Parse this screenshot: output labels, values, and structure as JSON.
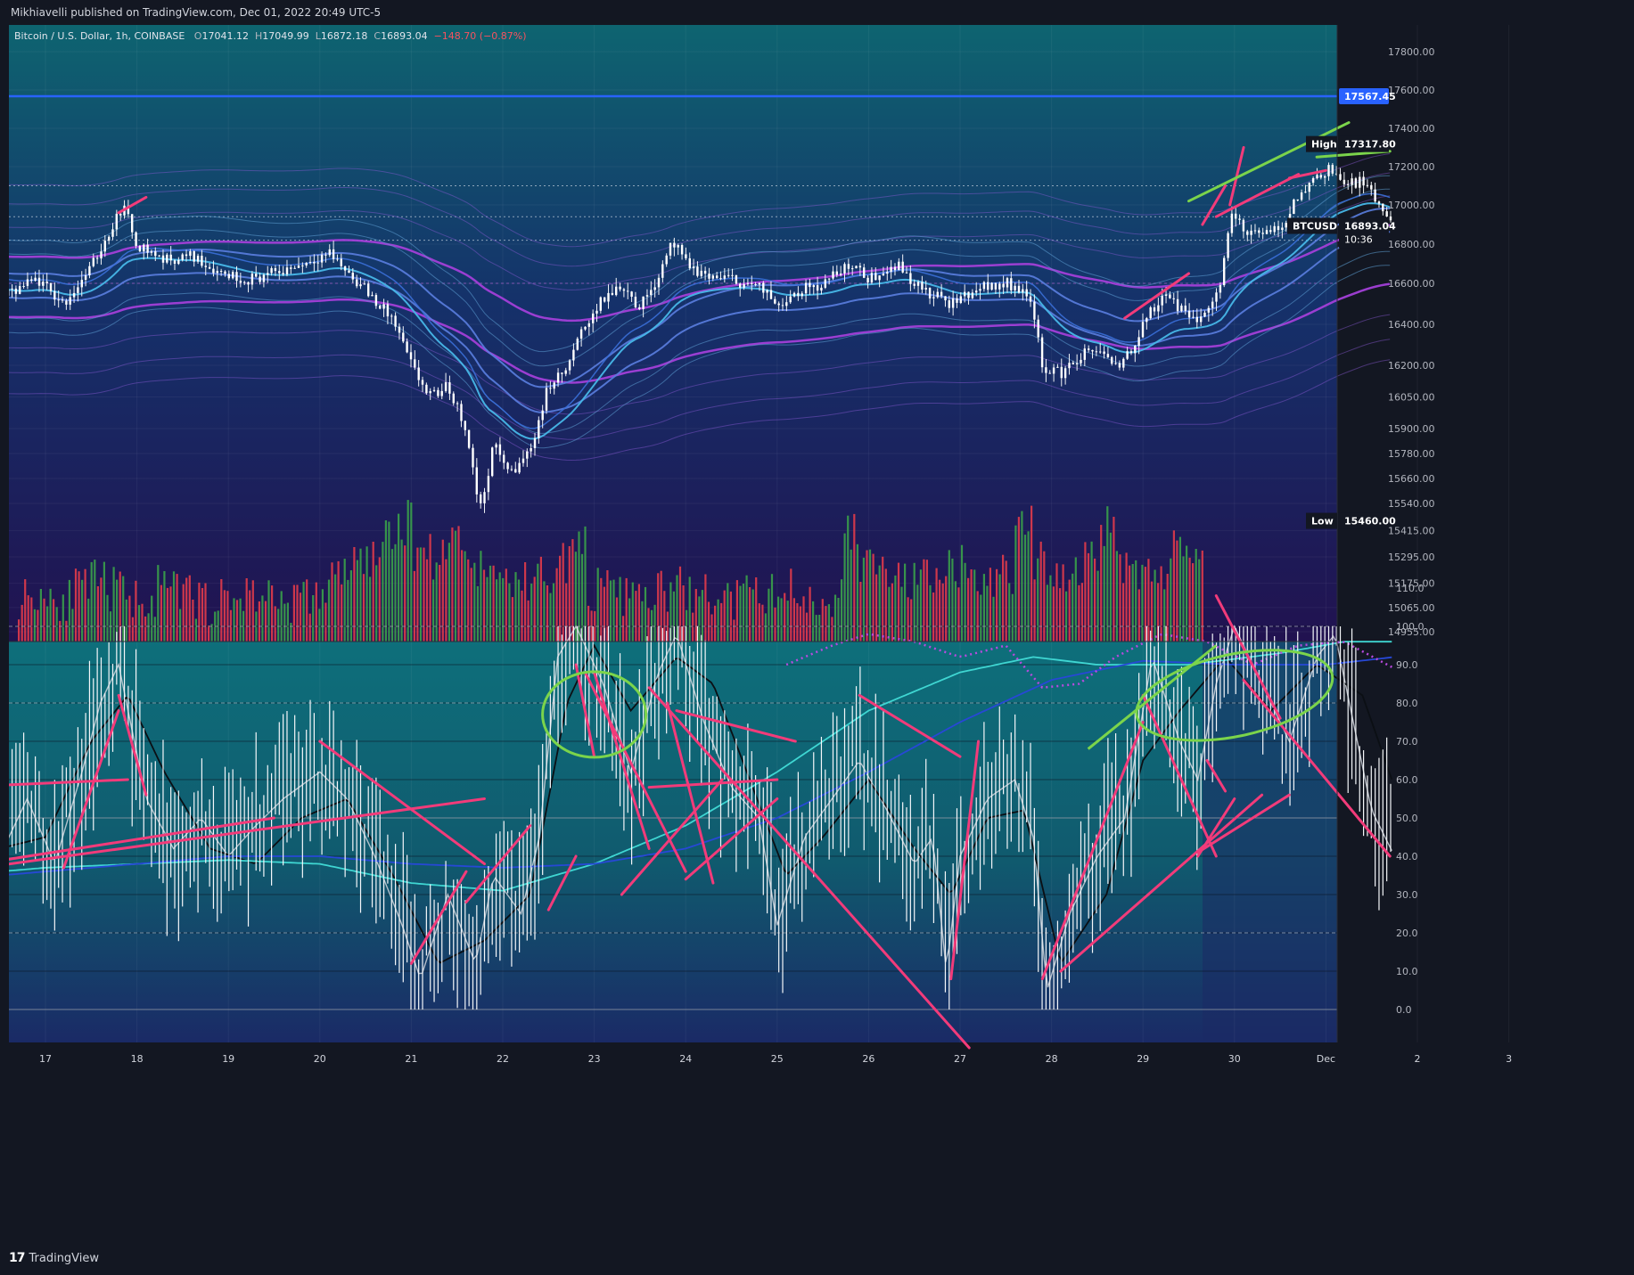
{
  "header": {
    "published": "Mikhiavelli published on TradingView.com, Dec 01, 2022 20:49 UTC-5"
  },
  "legend": {
    "symbol": "Bitcoin / U.S. Dollar, 1h, COINBASE",
    "open_label": "O",
    "open": "17041.12",
    "high_label": "H",
    "high": "17049.99",
    "low_label": "L",
    "low": "16872.18",
    "close_label": "C",
    "close": "16893.04",
    "change": "−148.70 (−0.87%)"
  },
  "branding": {
    "name": "TradingView"
  },
  "colors": {
    "up": "#26a69a",
    "down": "#ef5350",
    "accent": "#2962ff",
    "drawing_pink": "#f23b7a",
    "drawing_green": "#7bd44b",
    "panel_top": "#0d5f6e",
    "panel_bottom": "#221350"
  },
  "chart_data": [
    {
      "type": "candlestick",
      "title": "",
      "symbol": "BTCUSD",
      "timeframe": "1h",
      "x_ticks": [
        "17",
        "18",
        "19",
        "20",
        "21",
        "22",
        "23",
        "24",
        "25",
        "26",
        "27",
        "28",
        "29",
        "30",
        "Dec",
        "2",
        "3"
      ],
      "price_ticks": [
        17800.0,
        17600.0,
        17400.0,
        17200.0,
        17000.0,
        16800.0,
        16600.0,
        16400.0,
        16200.0,
        16050.0,
        15900.0,
        15780.0,
        15660.0,
        15540.0,
        15415.0,
        15295.0,
        15175.0,
        15065.0,
        14955.0
      ],
      "price_tick_labels": [
        "17800.00",
        "17600.00",
        "17400.00",
        "17200.00",
        "17000.00",
        "16800.00",
        "16600.00",
        "16400.00",
        "16200.00",
        "16050.00",
        "15900.00",
        "15780.00",
        "15660.00",
        "15540.00",
        "15415.00",
        "15295.00",
        "15175.00",
        "15065.00",
        "14955.00"
      ],
      "price_labels": [
        {
          "name": "",
          "text": "17567.45",
          "value": 17567.45,
          "color": "#2962ff"
        },
        {
          "name": "High",
          "text": "17317.80",
          "value": 17317.8,
          "color": "#131722"
        },
        {
          "name": "BTCUSD",
          "text": "16893.04",
          "sub": "10:36",
          "value": 16893.04,
          "color": "#131722"
        },
        {
          "name": "Low",
          "text": "15460.00",
          "value": 15460.0,
          "color": "#131722"
        }
      ],
      "horizontal_line": 17567.45,
      "close_path": [
        [
          16.0,
          16580
        ],
        [
          16.3,
          16660
        ],
        [
          16.6,
          16540
        ],
        [
          16.9,
          16620
        ],
        [
          17.2,
          16500
        ],
        [
          17.5,
          16680
        ],
        [
          17.85,
          17000
        ],
        [
          18.0,
          16800
        ],
        [
          18.3,
          16720
        ],
        [
          18.6,
          16740
        ],
        [
          18.9,
          16660
        ],
        [
          19.2,
          16620
        ],
        [
          19.5,
          16650
        ],
        [
          19.8,
          16700
        ],
        [
          20.1,
          16760
        ],
        [
          20.3,
          16660
        ],
        [
          20.6,
          16520
        ],
        [
          20.8,
          16420
        ],
        [
          21.0,
          16200
        ],
        [
          21.2,
          16050
        ],
        [
          21.4,
          16100
        ],
        [
          21.6,
          15900
        ],
        [
          21.75,
          15500
        ],
        [
          21.9,
          15820
        ],
        [
          22.1,
          15680
        ],
        [
          22.3,
          15800
        ],
        [
          22.5,
          16100
        ],
        [
          22.7,
          16180
        ],
        [
          22.9,
          16400
        ],
        [
          23.1,
          16520
        ],
        [
          23.3,
          16600
        ],
        [
          23.5,
          16480
        ],
        [
          23.7,
          16640
        ],
        [
          23.85,
          16820
        ],
        [
          24.0,
          16700
        ],
        [
          24.2,
          16640
        ],
        [
          24.5,
          16620
        ],
        [
          24.8,
          16580
        ],
        [
          25.0,
          16500
        ],
        [
          25.2,
          16560
        ],
        [
          25.5,
          16600
        ],
        [
          25.8,
          16700
        ],
        [
          26.0,
          16620
        ],
        [
          26.3,
          16700
        ],
        [
          26.6,
          16560
        ],
        [
          26.9,
          16500
        ],
        [
          27.2,
          16580
        ],
        [
          27.5,
          16600
        ],
        [
          27.75,
          16560
        ],
        [
          27.9,
          16200
        ],
        [
          28.1,
          16160
        ],
        [
          28.3,
          16240
        ],
        [
          28.5,
          16280
        ],
        [
          28.7,
          16180
        ],
        [
          28.9,
          16300
        ],
        [
          29.1,
          16480
        ],
        [
          29.3,
          16540
        ],
        [
          29.5,
          16420
        ],
        [
          29.7,
          16460
        ],
        [
          29.85,
          16600
        ],
        [
          29.95,
          16950
        ],
        [
          30.1,
          16880
        ],
        [
          30.3,
          16840
        ],
        [
          30.5,
          16880
        ],
        [
          30.7,
          17050
        ],
        [
          30.9,
          17150
        ],
        [
          31.05,
          17200
        ],
        [
          31.2,
          17100
        ],
        [
          31.4,
          17120
        ],
        [
          31.6,
          16980
        ],
        [
          31.75,
          16893
        ]
      ],
      "volume_profile": [
        0.22,
        0.25,
        0.2,
        0.28,
        0.35,
        0.3,
        0.22,
        0.2,
        0.3,
        0.25,
        0.18,
        0.16,
        0.2,
        0.25,
        0.22,
        0.18,
        0.2,
        0.24,
        0.4,
        0.55,
        0.6,
        0.75,
        0.95,
        0.7,
        0.6,
        0.85,
        0.5,
        0.45,
        0.4,
        0.35,
        0.45,
        0.55,
        0.7,
        0.3,
        0.25,
        0.22,
        0.2,
        0.25,
        0.3,
        0.22,
        0.2,
        0.18,
        0.22,
        0.25,
        0.28,
        0.2,
        0.18,
        0.22,
        0.85,
        0.55,
        0.45,
        0.35,
        0.4,
        0.3,
        0.5,
        0.4,
        0.35,
        0.45,
        0.9,
        0.55,
        0.45,
        0.5,
        0.6,
        0.9,
        0.55,
        0.5,
        0.45,
        0.7,
        0.55,
        0.4
      ]
    },
    {
      "type": "line",
      "title": "",
      "y_ticks": [
        110.0,
        100.0,
        90.0,
        80.0,
        70.0,
        60.0,
        50.0,
        40.0,
        30.0,
        20.0,
        10.0,
        0.0
      ],
      "y_tick_labels": [
        "110.0",
        "100.0",
        "90.0",
        "80.0",
        "70.0",
        "60.0",
        "50.0",
        "40.0",
        "30.0",
        "20.0",
        "10.0",
        "0.0"
      ],
      "ylim": [
        -10,
        110
      ],
      "guides": [
        100,
        80,
        50,
        20,
        0
      ],
      "series": [
        {
          "color": "#cfd3dc",
          "points": [
            [
              16.0,
              45
            ],
            [
              16.2,
              60
            ],
            [
              16.5,
              40
            ],
            [
              16.8,
              55
            ],
            [
              17.1,
              38
            ],
            [
              17.4,
              62
            ],
            [
              17.6,
              80
            ],
            [
              17.8,
              90
            ],
            [
              18.1,
              55
            ],
            [
              18.4,
              42
            ],
            [
              18.7,
              50
            ],
            [
              19.0,
              40
            ],
            [
              19.3,
              48
            ],
            [
              19.6,
              55
            ],
            [
              20.0,
              62
            ],
            [
              20.3,
              55
            ],
            [
              20.6,
              40
            ],
            [
              20.9,
              22
            ],
            [
              21.1,
              8
            ],
            [
              21.4,
              30
            ],
            [
              21.7,
              12
            ],
            [
              21.9,
              35
            ],
            [
              22.2,
              25
            ],
            [
              22.4,
              45
            ],
            [
              22.6,
              92
            ],
            [
              22.8,
              100
            ],
            [
              23.1,
              85
            ],
            [
              23.4,
              62
            ],
            [
              23.7,
              88
            ],
            [
              23.9,
              98
            ],
            [
              24.2,
              75
            ],
            [
              24.5,
              58
            ],
            [
              24.8,
              50
            ],
            [
              25.0,
              22
            ],
            [
              25.3,
              45
            ],
            [
              25.6,
              55
            ],
            [
              25.9,
              65
            ],
            [
              26.2,
              52
            ],
            [
              26.5,
              38
            ],
            [
              26.7,
              45
            ],
            [
              26.85,
              10
            ],
            [
              27.0,
              40
            ],
            [
              27.3,
              55
            ],
            [
              27.6,
              60
            ],
            [
              27.8,
              45
            ],
            [
              27.95,
              5
            ],
            [
              28.2,
              25
            ],
            [
              28.5,
              40
            ],
            [
              28.8,
              50
            ],
            [
              29.1,
              92
            ],
            [
              29.4,
              70
            ],
            [
              29.6,
              60
            ],
            [
              29.8,
              85
            ],
            [
              30.0,
              100
            ],
            [
              30.3,
              85
            ],
            [
              30.6,
              70
            ],
            [
              30.9,
              92
            ],
            [
              31.1,
              98
            ],
            [
              31.3,
              75
            ],
            [
              31.5,
              52
            ],
            [
              31.75,
              40
            ]
          ]
        },
        {
          "color": "#0b0f14",
          "points": [
            [
              16.0,
              40
            ],
            [
              16.5,
              42
            ],
            [
              17.0,
              45
            ],
            [
              17.5,
              70
            ],
            [
              17.9,
              82
            ],
            [
              18.3,
              62
            ],
            [
              18.8,
              42
            ],
            [
              19.3,
              38
            ],
            [
              19.8,
              50
            ],
            [
              20.3,
              55
            ],
            [
              20.8,
              35
            ],
            [
              21.3,
              12
            ],
            [
              21.8,
              18
            ],
            [
              22.3,
              30
            ],
            [
              22.7,
              80
            ],
            [
              23.0,
              95
            ],
            [
              23.4,
              78
            ],
            [
              23.9,
              92
            ],
            [
              24.3,
              85
            ],
            [
              24.7,
              60
            ],
            [
              25.1,
              35
            ],
            [
              25.5,
              45
            ],
            [
              26.0,
              60
            ],
            [
              26.5,
              42
            ],
            [
              26.9,
              30
            ],
            [
              27.3,
              50
            ],
            [
              27.7,
              52
            ],
            [
              28.1,
              12
            ],
            [
              28.6,
              30
            ],
            [
              29.0,
              65
            ],
            [
              29.4,
              78
            ],
            [
              29.9,
              92
            ],
            [
              30.4,
              78
            ],
            [
              30.9,
              90
            ],
            [
              31.4,
              82
            ],
            [
              31.75,
              58
            ]
          ]
        },
        {
          "color": "#3fd6d2",
          "points": [
            [
              16.0,
              35
            ],
            [
              17.0,
              37
            ],
            [
              18.0,
              38
            ],
            [
              19.0,
              39
            ],
            [
              20.0,
              38
            ],
            [
              21.0,
              33
            ],
            [
              22.0,
              31
            ],
            [
              23.0,
              38
            ],
            [
              24.0,
              48
            ],
            [
              25.0,
              62
            ],
            [
              26.0,
              78
            ],
            [
              27.0,
              88
            ],
            [
              27.8,
              92
            ],
            [
              28.5,
              90
            ],
            [
              29.5,
              90
            ],
            [
              30.5,
              93
            ],
            [
              31.2,
              96
            ],
            [
              31.75,
              96
            ]
          ]
        },
        {
          "color": "#2748d6",
          "points": [
            [
              16.0,
              34
            ],
            [
              17.0,
              36
            ],
            [
              18.0,
              38
            ],
            [
              19.0,
              40
            ],
            [
              20.0,
              40
            ],
            [
              21.0,
              38
            ],
            [
              22.0,
              37
            ],
            [
              23.0,
              38
            ],
            [
              24.0,
              42
            ],
            [
              25.0,
              50
            ],
            [
              26.0,
              62
            ],
            [
              27.0,
              75
            ],
            [
              28.0,
              86
            ],
            [
              29.0,
              91
            ],
            [
              30.0,
              90
            ],
            [
              31.0,
              90
            ],
            [
              31.75,
              92
            ]
          ]
        },
        {
          "color": "#b84adf",
          "points": [
            [
              25.1,
              90
            ],
            [
              25.6,
              95
            ],
            [
              26.0,
              98
            ],
            [
              26.5,
              96
            ],
            [
              27.0,
              92
            ],
            [
              27.5,
              95
            ],
            [
              27.9,
              84
            ],
            [
              28.3,
              85
            ],
            [
              28.7,
              92
            ],
            [
              29.2,
              98
            ],
            [
              29.7,
              96
            ],
            [
              30.2,
              90
            ],
            [
              30.7,
              95
            ],
            [
              31.2,
              96
            ],
            [
              31.75,
              89
            ]
          ]
        }
      ]
    }
  ]
}
